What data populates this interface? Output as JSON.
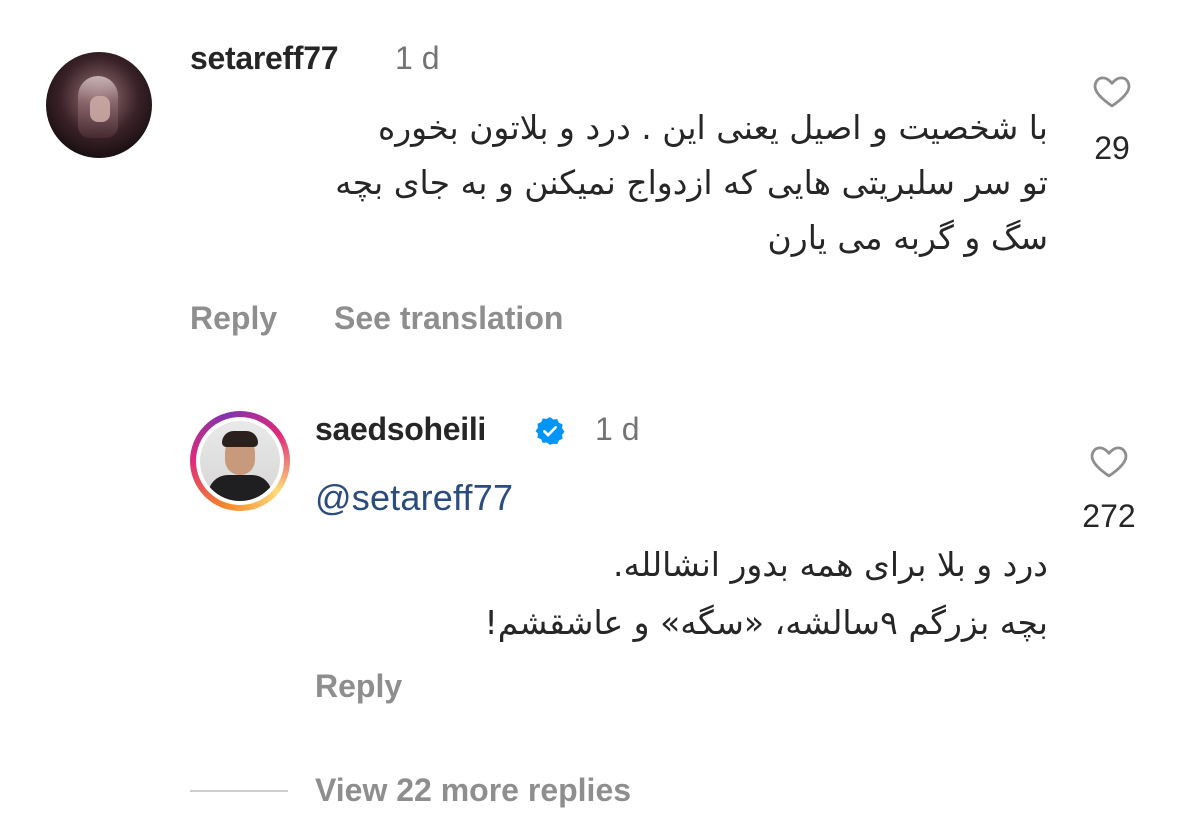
{
  "comment": {
    "username": "setareff77",
    "time": "1 d",
    "text_lines": [
      "با شخصیت و اصیل یعنی این . درد و بلاتون بخوره",
      "تو سر سلبریتی هایی که ازدواج نمیکنن و به جای بچه",
      "سگ و گربه می یارن"
    ],
    "like_count": "29",
    "reply_label": "Reply",
    "translate_label": "See translation"
  },
  "reply": {
    "username": "saedsoheili",
    "time": "1 d",
    "mention": "@setareff77",
    "text_lines": [
      "درد و بلا برای همه بدور انشالله.",
      "بچه بزرگم ۹سالشه، «سگه» و عاشقشم!"
    ],
    "like_count": "272",
    "reply_label": "Reply"
  },
  "more_replies_label": "View 22 more replies",
  "colors": {
    "verified": "#0095f6",
    "mention": "#2b4c7e",
    "secondary_text": "#8e8e8e"
  },
  "icons": {
    "heart": "heart-outline-icon",
    "verified": "verified-badge-icon"
  }
}
